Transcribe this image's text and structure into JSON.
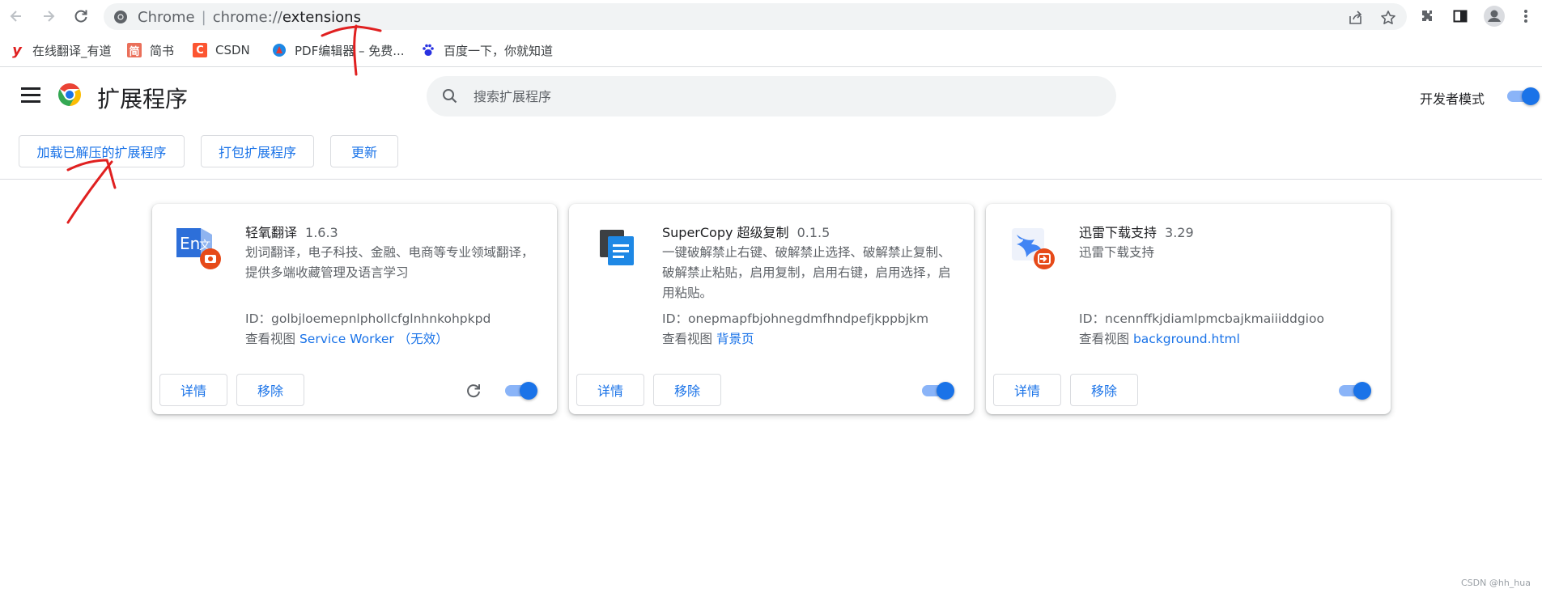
{
  "browser": {
    "site_label": "Chrome",
    "url_scheme": "chrome://",
    "url_host": "extensions"
  },
  "bookmarks": [
    {
      "label": "在线翻译_有道",
      "icon": "youdao-icon",
      "color": "#e02020",
      "glyph": "y"
    },
    {
      "label": "简书",
      "icon": "jianshu-icon",
      "color": "#ea6f5a",
      "glyph": "简"
    },
    {
      "label": "CSDN",
      "icon": "csdn-icon",
      "color": "#fc5531",
      "glyph": "C"
    },
    {
      "label": "PDF编辑器 – 免费...",
      "icon": "pdf-editor-icon",
      "color": "#e04040",
      "glyph": "P"
    },
    {
      "label": "百度一下，你就知道",
      "icon": "baidu-icon",
      "color": "#2932e1",
      "glyph": "百"
    }
  ],
  "header": {
    "title": "扩展程序",
    "search_placeholder": "搜索扩展程序",
    "dev_mode_label": "开发者模式",
    "dev_mode_on": true
  },
  "actions": {
    "load_unpacked": "加载已解压的扩展程序",
    "pack": "打包扩展程序",
    "update": "更新"
  },
  "extensions": [
    {
      "name": "轻氧翻译",
      "version": "1.6.3",
      "description": "划词翻译，电子科技、金融、电商等专业领域翻译，提供多端收藏管理及语言学习",
      "id_label": "ID：",
      "id": "golbjloemepnlphollcfglnhnkohpkpd",
      "views_label": "查看视图",
      "view_link": "Service Worker （无效）",
      "details": "详情",
      "remove": "移除",
      "enabled": true
    },
    {
      "name": "SuperCopy 超级复制",
      "version": "0.1.5",
      "description": "一键破解禁止右键、破解禁止选择、破解禁止复制、破解禁止粘贴，启用复制，启用右键，启用选择，启用粘贴。",
      "id_label": "ID：",
      "id": "onepmapfbjohnegdmfhndpefjkppbjkm",
      "views_label": "查看视图",
      "view_link": "背景页",
      "details": "详情",
      "remove": "移除",
      "enabled": true
    },
    {
      "name": "迅雷下载支持",
      "version": "3.29",
      "description": "迅雷下载支持",
      "id_label": "ID：",
      "id": "ncennffkjdiamlpmcbajkmaiiiddgioo",
      "views_label": "查看视图",
      "view_link": "background.html",
      "details": "详情",
      "remove": "移除",
      "enabled": true
    }
  ],
  "watermark": "CSDN @hh_hua",
  "colors": {
    "accent": "#1a73e8",
    "annotation": "#e02020"
  }
}
